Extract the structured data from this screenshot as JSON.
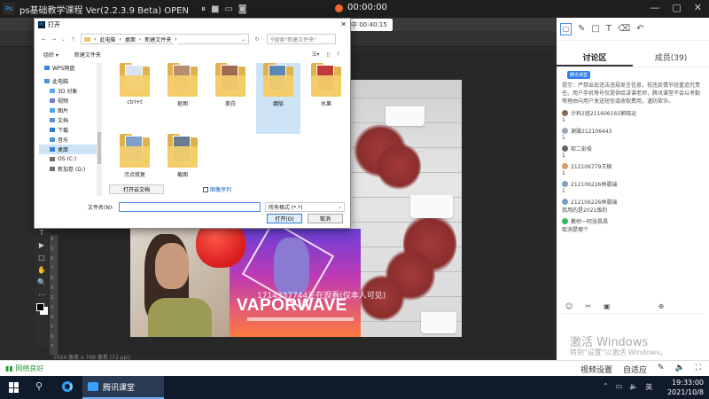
{
  "titlebar": {
    "logo": "Ps",
    "title": "ps基础教学课程 Ver(2.2.3.9 Beta)  OPEN",
    "record_time": "00:00:00",
    "icons": [
      "pause-icon",
      "stop-icon",
      "screen-icon",
      "camera-icon"
    ]
  },
  "upload": {
    "label": "上课中 00:40:15"
  },
  "dialog": {
    "title": "打开",
    "address": [
      "此电脑",
      "桌面",
      "新建文件夹"
    ],
    "search_placeholder": "搜索\"新建文件夹\"",
    "organize": "组织 ▾",
    "new_folder": "新建文件夹",
    "nav_items": [
      {
        "label": "WPS网盘",
        "color": "#3b86e0"
      },
      {
        "label": "此电脑",
        "color": "#4a90e2"
      },
      {
        "label": "3D 对象",
        "color": "#58a6ff"
      },
      {
        "label": "视频",
        "color": "#6f7bd8"
      },
      {
        "label": "图片",
        "color": "#4aa6e8"
      },
      {
        "label": "文档",
        "color": "#5b8ed6"
      },
      {
        "label": "下载",
        "color": "#2f7bd8"
      },
      {
        "label": "音乐",
        "color": "#4a90e2"
      },
      {
        "label": "桌面",
        "color": "#3d7fd6"
      },
      {
        "label": "OS (C:)",
        "color": "#6f6f6f"
      },
      {
        "label": "新加卷 (D:)",
        "color": "#6f6f6f"
      }
    ],
    "files": [
      {
        "label": "ctrl+t",
        "thumb": "#d9e4f2"
      },
      {
        "label": "抠图",
        "thumb": "#b88c70"
      },
      {
        "label": "美白",
        "thumb": "#a06a52"
      },
      {
        "label": "磨版",
        "thumb": "#5b87b8"
      },
      {
        "label": "水果",
        "thumb": "#c23a3a"
      },
      {
        "label": "污点修复",
        "thumb": "#7fa0c8"
      },
      {
        "label": "截图",
        "thumb": "#6b7b8f"
      }
    ],
    "cloud_button": "打开云文档",
    "sequence_label": "图像序列",
    "filename_label": "文件名(N):",
    "filename_value": "",
    "filetype": "所有格式 (*.*)",
    "open_button": "打开(O)",
    "cancel_button": "取消"
  },
  "canvas": {
    "vapor_title": "VAPORWAVE",
    "watermark": "1714337744正在观看(仅本人可见)",
    "status": "1024 像素 x 768 像素 (72 ppi)"
  },
  "ps_tools": [
    "T",
    "▶",
    "□",
    "✋",
    "🔍",
    "⋯"
  ],
  "ruler_numbers": [
    "4",
    "5",
    "6",
    "7",
    "8",
    "9",
    "2",
    "3",
    "4",
    "5",
    "6",
    "7"
  ],
  "right_panel": {
    "tabs": [
      {
        "label": "讨论区"
      },
      {
        "label": "成员(39)"
      }
    ],
    "tip_badge": "腾讯课堂",
    "tip": "提示：严禁出现违法违规发言信息，视违反情节轻重追究责任。用户手机等号仅提供给讲课老师，腾讯课堂不会以考勤等理由向用户发送短信或收取费用，谨防欺诈。",
    "messages": [
      {
        "name": "计科2班211606165郭晓运",
        "text": "1",
        "color": "#8a6a55"
      },
      {
        "name": "谢璇212106443",
        "text": "1",
        "color": "#9aa6b8"
      },
      {
        "name": "软二彭俊",
        "text": "1",
        "color": "#666666"
      },
      {
        "name": "212106779王楠",
        "text": "1",
        "color": "#d89a6a"
      },
      {
        "name": "212106226林震瑞",
        "text": "1",
        "color": "#7aa0c8"
      },
      {
        "name": "212106226林震瑞",
        "text": "我用的是2021版的",
        "color": "#7aa0c8"
      },
      {
        "name": "教师一阿张昌昌",
        "text": "取消是哪个",
        "color": "#35b85a"
      }
    ],
    "input_icons": [
      "smile-icon",
      "scissors-icon",
      "image-icon",
      "plus-icon"
    ]
  },
  "activate": {
    "line1": "激活 Windows",
    "line2": "转到\"设置\"以激活 Windows。"
  },
  "bottombar": {
    "net": "网络良好",
    "video_settings": "视频设置",
    "adaptive": "自适应"
  },
  "taskbar": {
    "app": "腾讯课堂",
    "time": "19:33:00",
    "date": "2021/10/8",
    "lang": "英"
  }
}
